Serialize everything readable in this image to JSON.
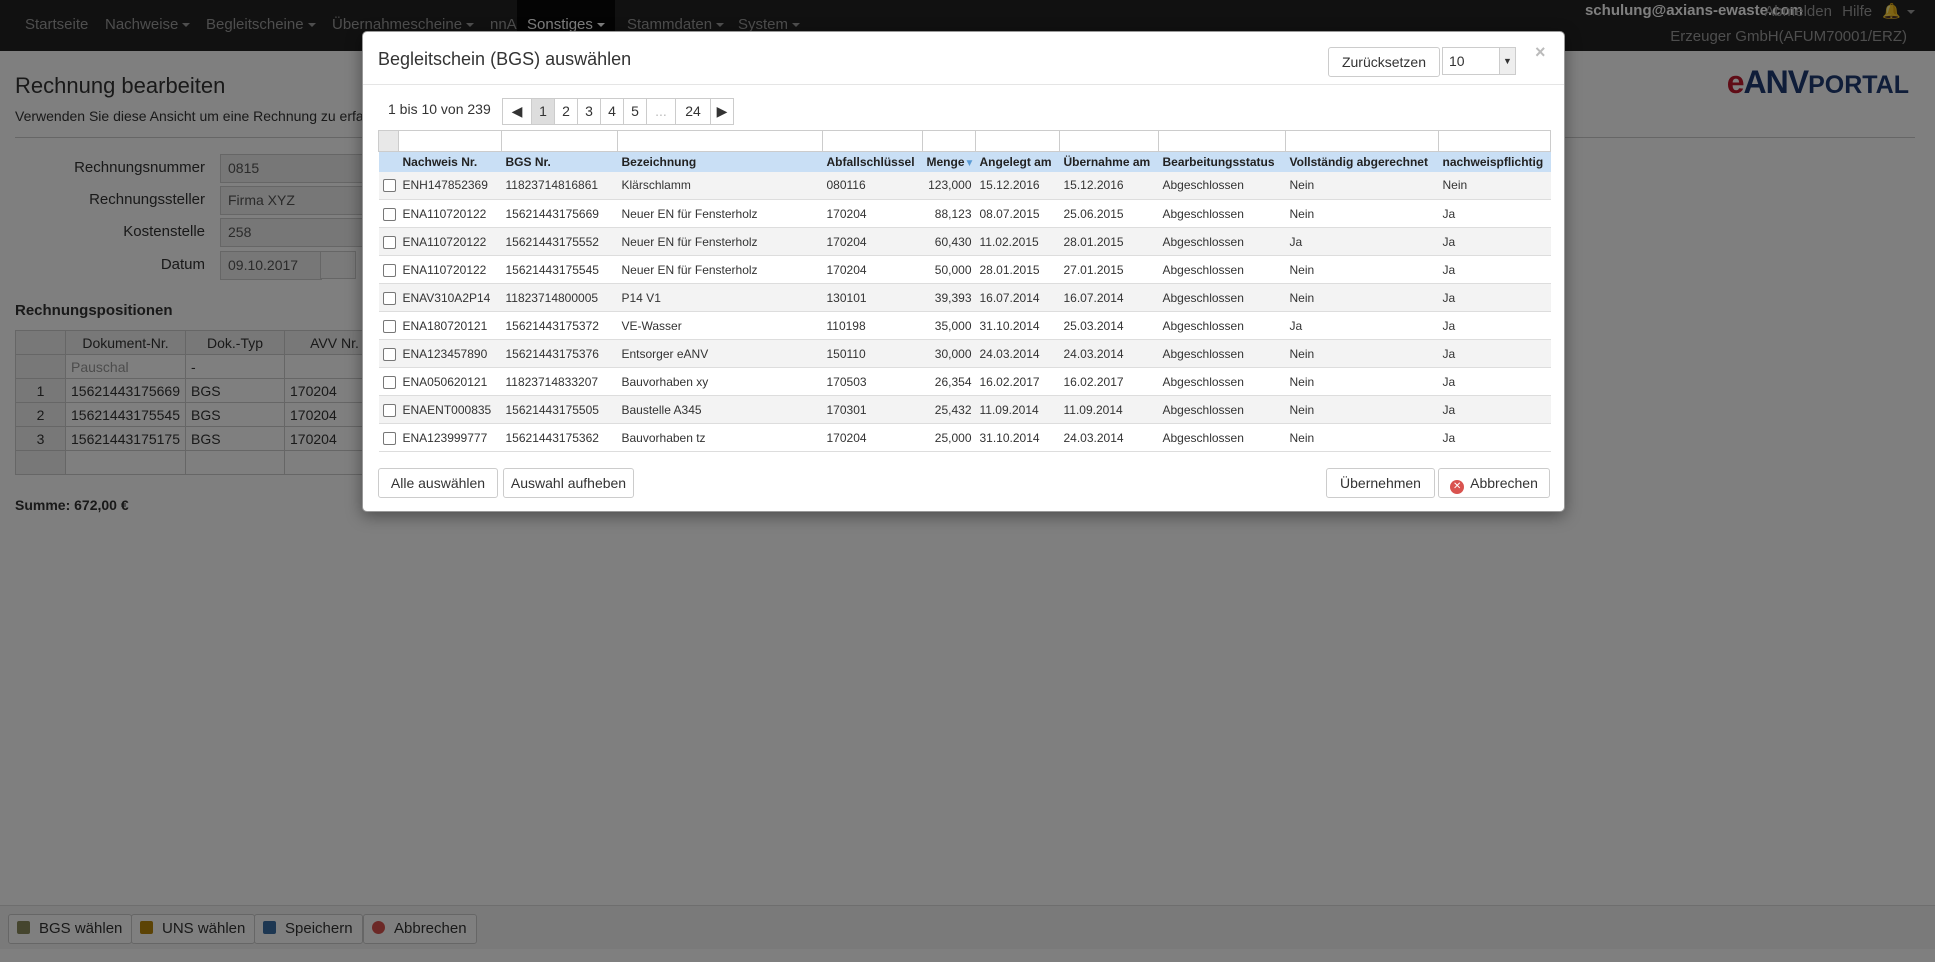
{
  "nav": {
    "items": [
      {
        "label": "Startseite",
        "caret": false,
        "active": false
      },
      {
        "label": "Nachweise",
        "caret": true,
        "active": false
      },
      {
        "label": "Begleitscheine",
        "caret": true,
        "active": false
      },
      {
        "label": "Übernahmescheine",
        "caret": true,
        "active": false
      },
      {
        "label": "nnA",
        "caret": false,
        "active": false
      },
      {
        "label": "Sonstiges",
        "caret": true,
        "active": true
      },
      {
        "label": "Stammdaten",
        "caret": true,
        "active": false
      },
      {
        "label": "System",
        "caret": true,
        "active": false
      }
    ],
    "user_email": "schulung@axians-ewaste.com",
    "logout": "Abmelden",
    "help": "Hilfe",
    "bell": "bell-icon",
    "company": "Erzeuger GmbH(AFUM70001/ERZ)"
  },
  "logo": {
    "e": "e",
    "anv": "ANV",
    "portal": "PORTAL"
  },
  "page": {
    "title": "Rechnung bearbeiten",
    "subtitle": "Verwenden Sie diese Ansicht um eine Rechnung zu erfa"
  },
  "form": {
    "fields": [
      {
        "label": "Rechnungsnummer",
        "value": "0815"
      },
      {
        "label": "Rechnungssteller",
        "value": "Firma XYZ"
      },
      {
        "label": "Kostenstelle",
        "value": "258"
      },
      {
        "label": "Datum",
        "value": "09.10.2017"
      }
    ]
  },
  "positions": {
    "title": "Rechnungspositionen",
    "headers": [
      "",
      "Dokument-Nr.",
      "Dok.-Typ",
      "AVV Nr."
    ],
    "rows": [
      {
        "nr": "",
        "doc": "Pauschal",
        "type": "-",
        "avv": ""
      },
      {
        "nr": "1",
        "doc": "15621443175669",
        "type": "BGS",
        "avv": "170204"
      },
      {
        "nr": "2",
        "doc": "15621443175545",
        "type": "BGS",
        "avv": "170204"
      },
      {
        "nr": "3",
        "doc": "15621443175175",
        "type": "BGS",
        "avv": "170204"
      },
      {
        "nr": "",
        "doc": "",
        "type": "",
        "avv": ""
      }
    ]
  },
  "sum": "Summe: 672,00 €",
  "bottom": {
    "bgs": "BGS wählen",
    "uns": "UNS wählen",
    "save": "Speichern",
    "cancel": "Abbrechen"
  },
  "modal": {
    "title": "Begleitschein (BGS) auswählen",
    "reset": "Zurücksetzen",
    "page_size": "10",
    "close": "×",
    "pager_info": "1 bis 10 von 239",
    "pages": [
      {
        "l": "◀",
        "w": 30,
        "c": "",
        "dim": false
      },
      {
        "l": "1",
        "w": 24,
        "c": "cur",
        "dim": false
      },
      {
        "l": "2",
        "w": 24,
        "c": "",
        "dim": false
      },
      {
        "l": "3",
        "w": 24,
        "c": "",
        "dim": false
      },
      {
        "l": "4",
        "w": 24,
        "c": "",
        "dim": false
      },
      {
        "l": "5",
        "w": 24,
        "c": "",
        "dim": false
      },
      {
        "l": "...",
        "w": 30,
        "c": "",
        "dim": true
      },
      {
        "l": "24",
        "w": 36,
        "c": "",
        "dim": false
      },
      {
        "l": "▶",
        "w": 24,
        "c": "",
        "dim": false
      }
    ],
    "columns": [
      "Nachweis Nr.",
      "BGS Nr.",
      "Bezeichnung",
      "Abfallschlüssel",
      "Menge",
      "Angelegt am",
      "Übernahme am",
      "Bearbeitungsstatus",
      "Vollständig abgerechnet",
      "nachweispflichtig"
    ],
    "rows": [
      [
        "ENH147852369",
        "11823714816861",
        "Klärschlamm",
        "080116",
        "123,000",
        "15.12.2016",
        "15.12.2016",
        "Abgeschlossen",
        "Nein",
        "Nein"
      ],
      [
        "ENA110720122",
        "15621443175669",
        "Neuer EN für Fensterholz",
        "170204",
        "88,123",
        "08.07.2015",
        "25.06.2015",
        "Abgeschlossen",
        "Nein",
        "Ja"
      ],
      [
        "ENA110720122",
        "15621443175552",
        "Neuer EN für Fensterholz",
        "170204",
        "60,430",
        "11.02.2015",
        "28.01.2015",
        "Abgeschlossen",
        "Ja",
        "Ja"
      ],
      [
        "ENA110720122",
        "15621443175545",
        "Neuer EN für Fensterholz",
        "170204",
        "50,000",
        "28.01.2015",
        "27.01.2015",
        "Abgeschlossen",
        "Nein",
        "Ja"
      ],
      [
        "ENAV310A2P14",
        "11823714800005",
        "P14 V1",
        "130101",
        "39,393",
        "16.07.2014",
        "16.07.2014",
        "Abgeschlossen",
        "Nein",
        "Ja"
      ],
      [
        "ENA180720121",
        "15621443175372",
        "VE-Wasser",
        "110198",
        "35,000",
        "31.10.2014",
        "25.03.2014",
        "Abgeschlossen",
        "Ja",
        "Ja"
      ],
      [
        "ENA123457890",
        "15621443175376",
        "Entsorger eANV",
        "150110",
        "30,000",
        "24.03.2014",
        "24.03.2014",
        "Abgeschlossen",
        "Nein",
        "Ja"
      ],
      [
        "ENA050620121",
        "11823714833207",
        "Bauvorhaben xy",
        "170503",
        "26,354",
        "16.02.2017",
        "16.02.2017",
        "Abgeschlossen",
        "Nein",
        "Ja"
      ],
      [
        "ENAENT000835",
        "15621443175505",
        "Baustelle A345",
        "170301",
        "25,432",
        "11.09.2014",
        "11.09.2014",
        "Abgeschlossen",
        "Nein",
        "Ja"
      ],
      [
        "ENA123999777",
        "15621443175362",
        "Bauvorhaben tz",
        "170204",
        "25,000",
        "31.10.2014",
        "24.03.2014",
        "Abgeschlossen",
        "Nein",
        "Ja"
      ]
    ],
    "select_all": "Alle auswählen",
    "deselect": "Auswahl aufheben",
    "apply": "Übernehmen",
    "cancel": "Abbrechen"
  }
}
